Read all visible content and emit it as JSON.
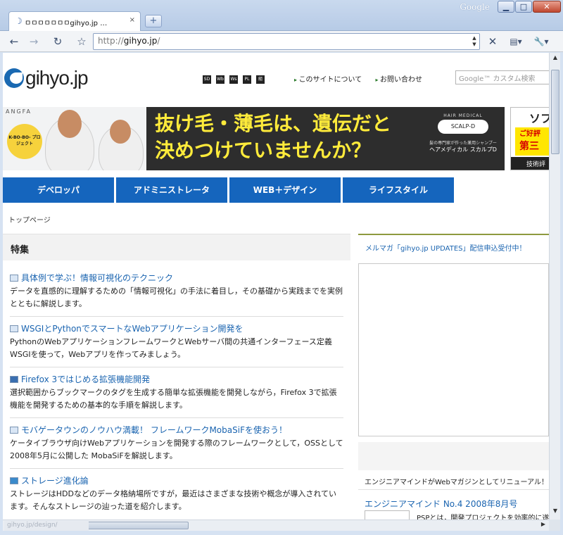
{
  "browser": {
    "brand": "Google",
    "tab_title": "ㅁㅁㅁㅁㅁㅁㅁgihyo.jp … ",
    "tab_close": "×",
    "new_tab": "+",
    "url_scheme": "http://",
    "url_host": "gihyo.jp",
    "url_path": "/",
    "win_min": "▁",
    "win_max": "□",
    "win_close": "✕",
    "back": "←",
    "forward": "→",
    "reload": "↻",
    "star": "☆",
    "stop": "✕",
    "page_menu": "▤▾",
    "tools_menu": "🔧▾"
  },
  "site": {
    "logo_text": "gihyo.jp",
    "icons": [
      "SD",
      "Wb",
      "Ws",
      "PL",
      "組"
    ],
    "header_links": [
      "このサイトについて",
      "お問い合わせ"
    ],
    "search_placeholder": "Google™ カスタム検索"
  },
  "banner": {
    "brand": "ANGFA",
    "badge": "K-BO-BO-\nプロジェクト",
    "copy_line1": "抜け毛・薄毛は、遺伝だと",
    "copy_line2": "決めつけていませんか？",
    "product_head": "HAIR MEDICAL",
    "product_logo": "SCALP-D",
    "product_tag": "髪の専門家が作った薬用シャンプー",
    "product_name": "ヘアメディカル スカルプD"
  },
  "banner2": {
    "title": "ソフ",
    "red1": "ご好評",
    "red2": "第三",
    "bottom": "技術評"
  },
  "nav": [
    "デベロッパ",
    "アドミニストレータ",
    "WEB＋デザイン",
    "ライフスタイル"
  ],
  "breadcrumb": "トップページ",
  "features": {
    "heading": "特集",
    "articles": [
      {
        "title": "具体例で学ぶ！情報可視化のテクニック",
        "desc": "データを直感的に理解するための「情報可視化」の手法に着目し，その基礎から実践までを実例とともに解説します。"
      },
      {
        "title": "WSGIとPythonでスマートなWebアプリケーション開発を",
        "desc": "PythonのWebアプリケーションフレームワークとWebサーバ間の共通インターフェース定義WSGIを使って，Webアプリを作ってみましょう。"
      },
      {
        "title": "Firefox 3ではじめる拡張機能開発",
        "desc": "選択範囲からブックマークのタグを生成する簡単な拡張機能を開発しながら，Firefox 3で拡張機能を開発するための基本的な手順を解説します。"
      },
      {
        "title": "モバゲータウンのノウハウ満載！ フレームワークMobaSiFを使おう！",
        "desc": "ケータイブラウザ向けWebアプリケーションを開発する際のフレームワークとして，OSSとして2008年5月に公開した MobaSiFを解説します。"
      },
      {
        "title": "ストレージ進化論",
        "desc": "ストレージはHDDなどのデータ格納場所ですが，最近はさまざまな技術や概念が導入されています。そんなストレージの辿った道を紹介します。"
      }
    ]
  },
  "sidebar": {
    "mailmag": "メルマガ「gihyo.jp UPDATES」配信申込受付中！",
    "renewal": "エンジニアマインドがWebマガジンとしてリニューアル！",
    "magazine_title": "エンジニアマインド No.4 2008年8月号",
    "magazine_desc": "PSPとは，開発プロジェクトを効率的に遂"
  },
  "status": "gihyo.jp/design/"
}
